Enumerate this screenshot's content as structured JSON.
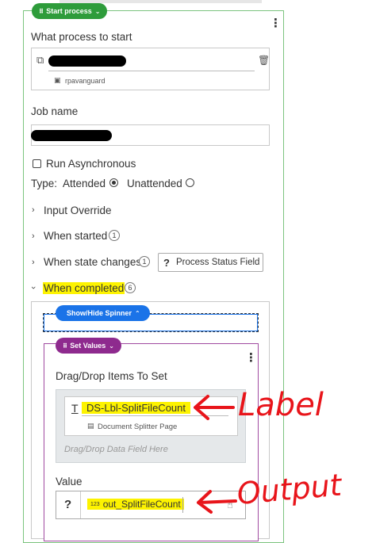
{
  "process_header": {
    "pill_label": "Start process"
  },
  "what_process": {
    "label": "What process to start",
    "machine": "rpavanguard"
  },
  "job_name": {
    "label": "Job name"
  },
  "run_async": {
    "label": "Run Asynchronous"
  },
  "type": {
    "label": "Type:",
    "attended": "Attended",
    "unattended": "Unattended",
    "selected": "Attended"
  },
  "sections": {
    "input_override": "Input Override",
    "when_started": "When started",
    "when_started_count": "1",
    "when_state_changes": "When state changes",
    "when_state_changes_count": "1",
    "process_status_field": "Process Status Field",
    "when_completed": "When completed",
    "when_completed_count": "6"
  },
  "spinner_step": {
    "pill_label": "Show/Hide Spinner"
  },
  "set_values_step": {
    "pill_label": "Set Values",
    "items_label": "Drag/Drop Items To Set",
    "item_name": "DS-Lbl-SplitFileCount",
    "item_page": "Document Splitter Page",
    "drop_placeholder": "Drag/Drop Data Field Here",
    "value_label": "Value",
    "value_type_badge": "123",
    "value_name": "out_SplitFileCount"
  },
  "annotations": {
    "label": "Label",
    "output": "Output"
  },
  "colors": {
    "step_green": "#2e9c3b",
    "step_blue": "#1a73e8",
    "step_purple": "#8e2a8e",
    "highlight": "#fdf300",
    "annotation_red": "#e8141a"
  }
}
